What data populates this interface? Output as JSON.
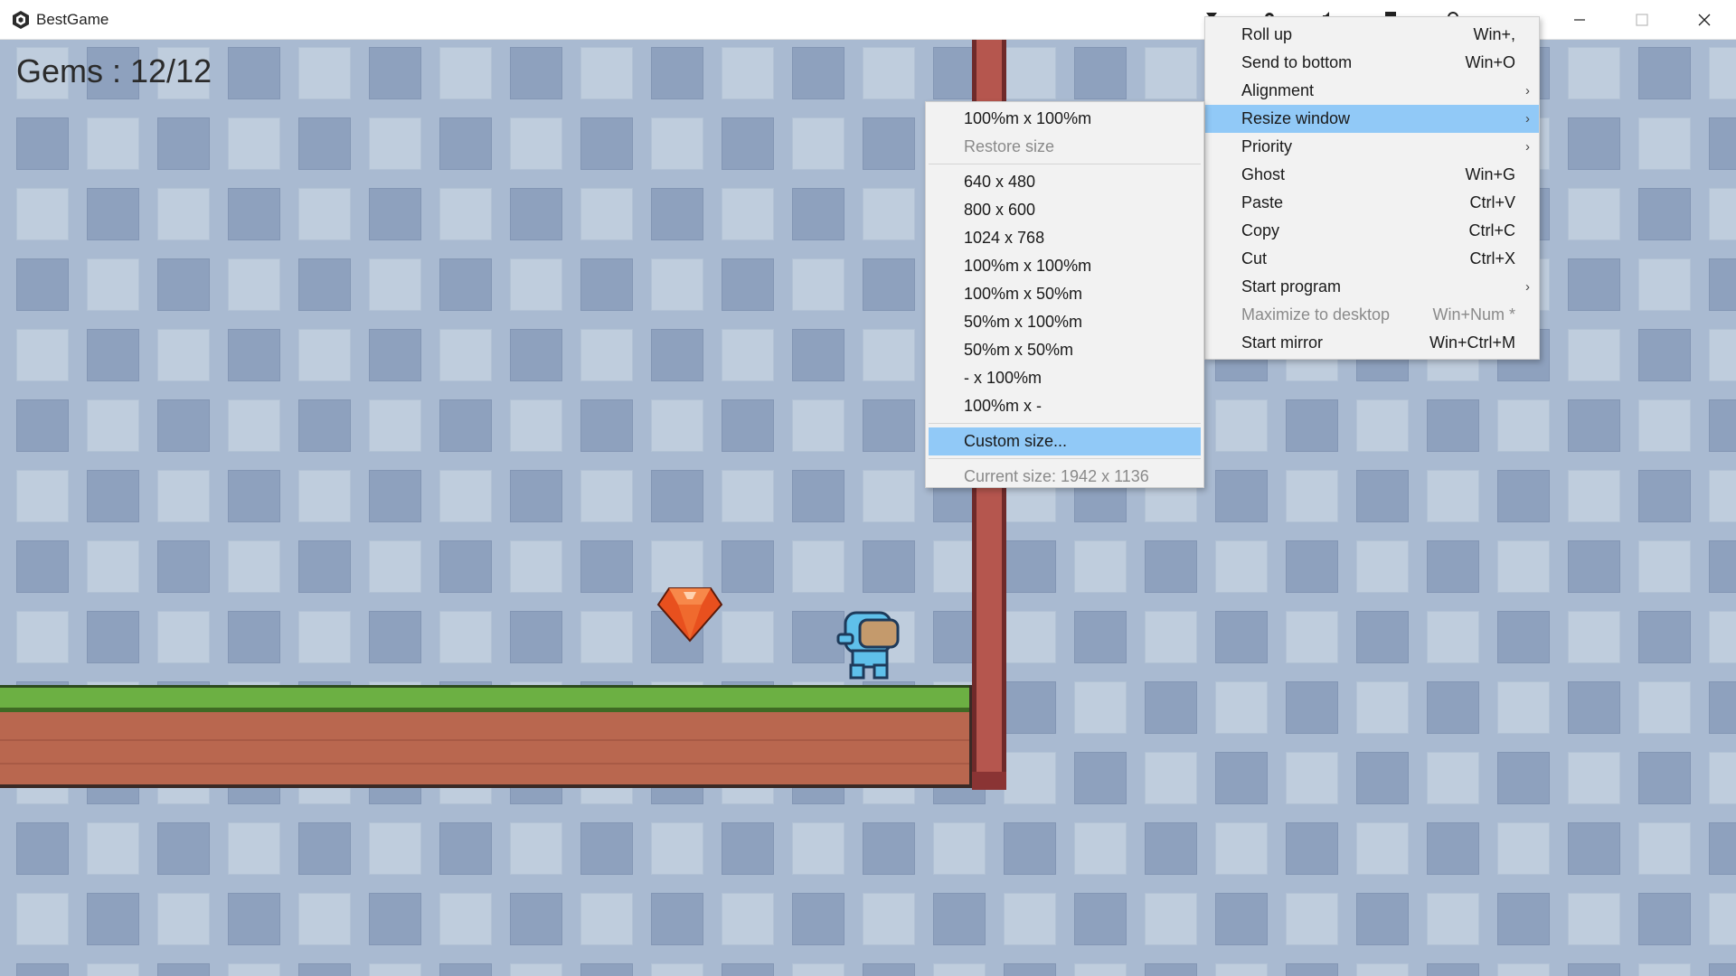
{
  "window": {
    "title": "BestGame",
    "icon": "unity-logo-icon"
  },
  "tray_icons": [
    "filter-icon",
    "gear-icon",
    "speaker-icon",
    "square-icon",
    "settings-icon"
  ],
  "window_controls": [
    "minimize-icon",
    "maximize-icon",
    "close-icon"
  ],
  "hud": {
    "gems_label": "Gems : 12/12"
  },
  "main_menu": {
    "items": [
      {
        "label": "Roll up",
        "shortcut": "Win+,",
        "submenu": false,
        "disabled": false,
        "highlighted": false
      },
      {
        "label": "Send to bottom",
        "shortcut": "Win+O",
        "submenu": false,
        "disabled": false,
        "highlighted": false
      },
      {
        "label": "Alignment",
        "shortcut": "",
        "submenu": true,
        "disabled": false,
        "highlighted": false
      },
      {
        "label": "Resize window",
        "shortcut": "",
        "submenu": true,
        "disabled": false,
        "highlighted": true
      },
      {
        "label": "Priority",
        "shortcut": "",
        "submenu": true,
        "disabled": false,
        "highlighted": false
      },
      {
        "label": "Ghost",
        "shortcut": "Win+G",
        "submenu": false,
        "disabled": false,
        "highlighted": false
      },
      {
        "label": "Paste",
        "shortcut": "Ctrl+V",
        "submenu": false,
        "disabled": false,
        "highlighted": false
      },
      {
        "label": "Copy",
        "shortcut": "Ctrl+C",
        "submenu": false,
        "disabled": false,
        "highlighted": false
      },
      {
        "label": "Cut",
        "shortcut": "Ctrl+X",
        "submenu": false,
        "disabled": false,
        "highlighted": false
      },
      {
        "label": "Start program",
        "shortcut": "",
        "submenu": true,
        "disabled": false,
        "highlighted": false
      },
      {
        "label": "Maximize to desktop",
        "shortcut": "Win+Num *",
        "submenu": false,
        "disabled": true,
        "highlighted": false
      },
      {
        "label": "Start mirror",
        "shortcut": "Win+Ctrl+M",
        "submenu": false,
        "disabled": false,
        "highlighted": false
      }
    ]
  },
  "resize_submenu": {
    "top_items": [
      {
        "label": "100%m x 100%m",
        "disabled": false
      },
      {
        "label": "Restore size",
        "disabled": true
      }
    ],
    "size_items": [
      {
        "label": "640 x 480"
      },
      {
        "label": "800 x 600"
      },
      {
        "label": "1024 x 768"
      },
      {
        "label": "100%m x 100%m"
      },
      {
        "label": "100%m x 50%m"
      },
      {
        "label": "50%m x 100%m"
      },
      {
        "label": "50%m x 50%m"
      },
      {
        "label": "- x 100%m"
      },
      {
        "label": "100%m x -"
      }
    ],
    "custom_label": "Custom size...",
    "current_size_label": "Current size: 1942 x 1136"
  },
  "colors": {
    "menu_highlight": "#91c9f7",
    "grass": "#6cb043",
    "dirt": "#b9674f",
    "wall": "#b5564e",
    "gem": "#e8501e"
  }
}
